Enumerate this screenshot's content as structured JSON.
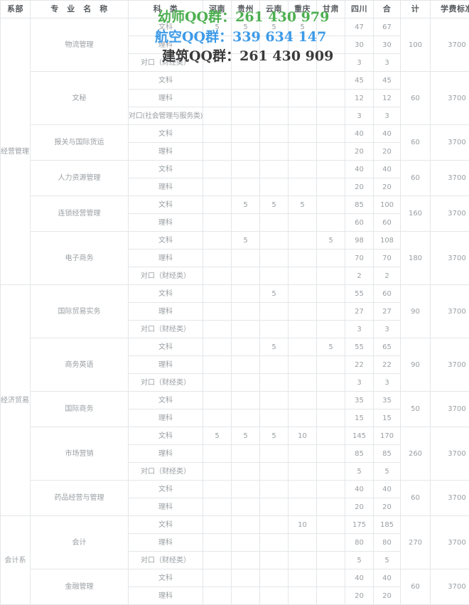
{
  "table": {
    "headers": [
      {
        "key": "dept",
        "label": "系部"
      },
      {
        "key": "major",
        "label": "专　业　名　称"
      },
      {
        "key": "kelei",
        "label": "科　类"
      },
      {
        "key": "henan",
        "label": "河南"
      },
      {
        "key": "guizhou",
        "label": "贵州"
      },
      {
        "key": "yunnan",
        "label": "云南"
      },
      {
        "key": "chongqing",
        "label": "重庆"
      },
      {
        "key": "gansu",
        "label": "甘肃"
      },
      {
        "key": "sichuan",
        "label": "四川"
      },
      {
        "key": "he",
        "label": "合"
      },
      {
        "key": "ji",
        "label": "计"
      },
      {
        "key": "fee",
        "label": "学费标准"
      }
    ],
    "departments": [
      {
        "name": "经营管理系",
        "majors": [
          {
            "name": "物流管理",
            "total": "100",
            "fee": "3700",
            "rows": [
              {
                "kelei": "文科",
                "henan": "5",
                "guizhou": "5",
                "yunnan": "5",
                "chongqing": "5",
                "gansu": "",
                "sichuan": "47",
                "he": "67"
              },
              {
                "kelei": "理科",
                "henan": "",
                "guizhou": "",
                "yunnan": "",
                "chongqing": "",
                "gansu": "",
                "sichuan": "30",
                "he": "30"
              },
              {
                "kelei": "对口（财经类）",
                "henan": "",
                "guizhou": "",
                "yunnan": "",
                "chongqing": "",
                "gansu": "",
                "sichuan": "3",
                "he": "3"
              }
            ]
          },
          {
            "name": "文秘",
            "total": "60",
            "fee": "3700",
            "rows": [
              {
                "kelei": "文科",
                "henan": "",
                "guizhou": "",
                "yunnan": "",
                "chongqing": "",
                "gansu": "",
                "sichuan": "45",
                "he": "45"
              },
              {
                "kelei": "理科",
                "henan": "",
                "guizhou": "",
                "yunnan": "",
                "chongqing": "",
                "gansu": "",
                "sichuan": "12",
                "he": "12"
              },
              {
                "kelei": "对口(社会管理与服务类)",
                "henan": "",
                "guizhou": "",
                "yunnan": "",
                "chongqing": "",
                "gansu": "",
                "sichuan": "3",
                "he": "3"
              }
            ]
          },
          {
            "name": "报关与国际货运",
            "total": "60",
            "fee": "3700",
            "rows": [
              {
                "kelei": "文科",
                "henan": "",
                "guizhou": "",
                "yunnan": "",
                "chongqing": "",
                "gansu": "",
                "sichuan": "40",
                "he": "40"
              },
              {
                "kelei": "理科",
                "henan": "",
                "guizhou": "",
                "yunnan": "",
                "chongqing": "",
                "gansu": "",
                "sichuan": "20",
                "he": "20"
              }
            ]
          },
          {
            "name": "人力资源管理",
            "total": "60",
            "fee": "3700",
            "rows": [
              {
                "kelei": "文科",
                "henan": "",
                "guizhou": "",
                "yunnan": "",
                "chongqing": "",
                "gansu": "",
                "sichuan": "40",
                "he": "40"
              },
              {
                "kelei": "理科",
                "henan": "",
                "guizhou": "",
                "yunnan": "",
                "chongqing": "",
                "gansu": "",
                "sichuan": "20",
                "he": "20"
              }
            ]
          },
          {
            "name": "连锁经营管理",
            "total": "160",
            "fee": "3700",
            "rows": [
              {
                "kelei": "文科",
                "henan": "",
                "guizhou": "5",
                "yunnan": "5",
                "chongqing": "5",
                "gansu": "",
                "sichuan": "85",
                "he": "100"
              },
              {
                "kelei": "理科",
                "henan": "",
                "guizhou": "",
                "yunnan": "",
                "chongqing": "",
                "gansu": "",
                "sichuan": "60",
                "he": "60"
              }
            ]
          },
          {
            "name": "电子商务",
            "total": "180",
            "fee": "3700",
            "rows": [
              {
                "kelei": "文科",
                "henan": "",
                "guizhou": "5",
                "yunnan": "",
                "chongqing": "",
                "gansu": "5",
                "sichuan": "98",
                "he": "108"
              },
              {
                "kelei": "理科",
                "henan": "",
                "guizhou": "",
                "yunnan": "",
                "chongqing": "",
                "gansu": "",
                "sichuan": "70",
                "he": "70"
              },
              {
                "kelei": "对口（财经类）",
                "henan": "",
                "guizhou": "",
                "yunnan": "",
                "chongqing": "",
                "gansu": "",
                "sichuan": "2",
                "he": "2"
              }
            ]
          }
        ]
      },
      {
        "name": "经济贸易系",
        "majors": [
          {
            "name": "国际贸易实务",
            "total": "90",
            "fee": "3700",
            "rows": [
              {
                "kelei": "文科",
                "henan": "",
                "guizhou": "",
                "yunnan": "5",
                "chongqing": "",
                "gansu": "",
                "sichuan": "55",
                "he": "60"
              },
              {
                "kelei": "理科",
                "henan": "",
                "guizhou": "",
                "yunnan": "",
                "chongqing": "",
                "gansu": "",
                "sichuan": "27",
                "he": "27"
              },
              {
                "kelei": "对口（财经类）",
                "henan": "",
                "guizhou": "",
                "yunnan": "",
                "chongqing": "",
                "gansu": "",
                "sichuan": "3",
                "he": "3"
              }
            ]
          },
          {
            "name": "商务英语",
            "total": "90",
            "fee": "3700",
            "rows": [
              {
                "kelei": "文科",
                "henan": "",
                "guizhou": "",
                "yunnan": "5",
                "chongqing": "",
                "gansu": "5",
                "sichuan": "55",
                "he": "65"
              },
              {
                "kelei": "理科",
                "henan": "",
                "guizhou": "",
                "yunnan": "",
                "chongqing": "",
                "gansu": "",
                "sichuan": "22",
                "he": "22"
              },
              {
                "kelei": "对口（财经类）",
                "henan": "",
                "guizhou": "",
                "yunnan": "",
                "chongqing": "",
                "gansu": "",
                "sichuan": "3",
                "he": "3"
              }
            ]
          },
          {
            "name": "国际商务",
            "total": "50",
            "fee": "3700",
            "rows": [
              {
                "kelei": "文科",
                "henan": "",
                "guizhou": "",
                "yunnan": "",
                "chongqing": "",
                "gansu": "",
                "sichuan": "35",
                "he": "35"
              },
              {
                "kelei": "理科",
                "henan": "",
                "guizhou": "",
                "yunnan": "",
                "chongqing": "",
                "gansu": "",
                "sichuan": "15",
                "he": "15"
              }
            ]
          },
          {
            "name": "市场营销",
            "total": "260",
            "fee": "3700",
            "rows": [
              {
                "kelei": "文科",
                "henan": "5",
                "guizhou": "5",
                "yunnan": "5",
                "chongqing": "10",
                "gansu": "",
                "sichuan": "145",
                "he": "170"
              },
              {
                "kelei": "理科",
                "henan": "",
                "guizhou": "",
                "yunnan": "",
                "chongqing": "",
                "gansu": "",
                "sichuan": "85",
                "he": "85"
              },
              {
                "kelei": "对口（财经类）",
                "henan": "",
                "guizhou": "",
                "yunnan": "",
                "chongqing": "",
                "gansu": "",
                "sichuan": "5",
                "he": "5"
              }
            ]
          },
          {
            "name": "药品经营与管理",
            "total": "60",
            "fee": "3700",
            "rows": [
              {
                "kelei": "文科",
                "henan": "",
                "guizhou": "",
                "yunnan": "",
                "chongqing": "",
                "gansu": "",
                "sichuan": "40",
                "he": "40"
              },
              {
                "kelei": "理科",
                "henan": "",
                "guizhou": "",
                "yunnan": "",
                "chongqing": "",
                "gansu": "",
                "sichuan": "20",
                "he": "20"
              }
            ]
          }
        ]
      },
      {
        "name": "会计系",
        "majors": [
          {
            "name": "会计",
            "total": "270",
            "fee": "3700",
            "rows": [
              {
                "kelei": "文科",
                "henan": "",
                "guizhou": "",
                "yunnan": "",
                "chongqing": "10",
                "gansu": "",
                "sichuan": "175",
                "he": "185"
              },
              {
                "kelei": "理科",
                "henan": "",
                "guizhou": "",
                "yunnan": "",
                "chongqing": "",
                "gansu": "",
                "sichuan": "80",
                "he": "80"
              },
              {
                "kelei": "对口（财经类）",
                "henan": "",
                "guizhou": "",
                "yunnan": "",
                "chongqing": "",
                "gansu": "",
                "sichuan": "5",
                "he": "5"
              }
            ]
          },
          {
            "name": "金融管理",
            "total": "60",
            "fee": "3700",
            "rows": [
              {
                "kelei": "文科",
                "henan": "",
                "guizhou": "",
                "yunnan": "",
                "chongqing": "",
                "gansu": "",
                "sichuan": "40",
                "he": "40"
              },
              {
                "kelei": "理科",
                "henan": "",
                "guizhou": "",
                "yunnan": "",
                "chongqing": "",
                "gansu": "",
                "sichuan": "20",
                "he": "20"
              }
            ]
          }
        ]
      }
    ]
  },
  "watermark": {
    "youshi": "幼师QQ群：261 430 979",
    "hangkong": "航空QQ群：339 634 147",
    "jianzhu": "建筑QQ群：261 430 909",
    "color_youshi": "#4caf50",
    "color_hangkong": "#3d9ae8",
    "color_jianzhu": "#3a3a3a"
  }
}
